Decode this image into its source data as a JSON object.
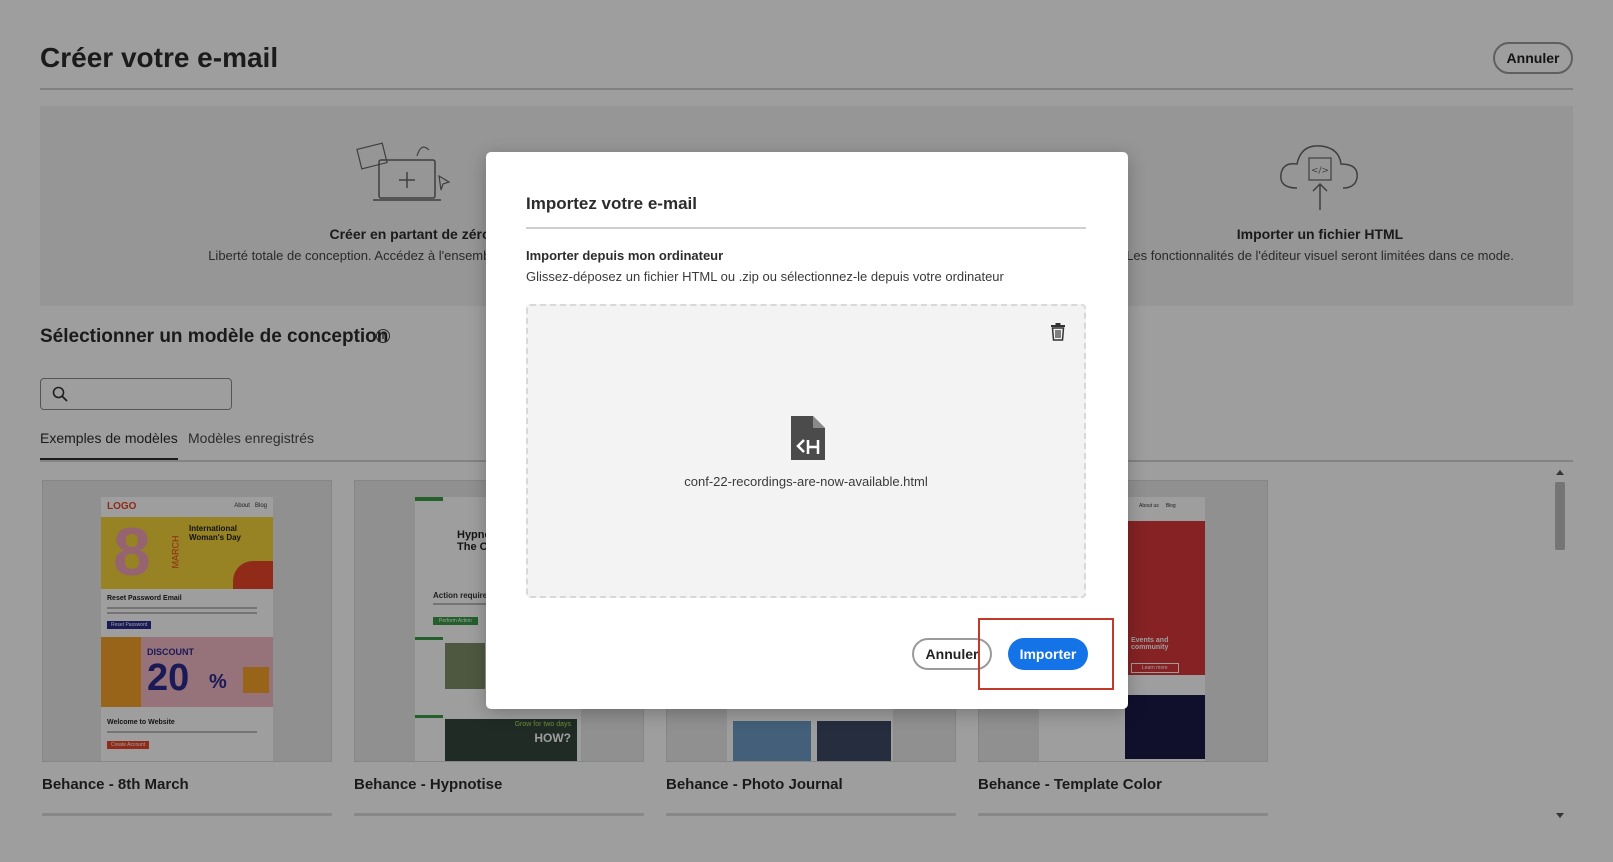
{
  "page": {
    "title": "Créer votre e-mail",
    "cancel_label": "Annuler"
  },
  "options": {
    "scratch": {
      "title": "Créer en partant de zéro",
      "description": "Liberté totale de conception. Accédez à l'ensemble des fonctionnalités"
    },
    "html": {
      "title": "Importer un fichier HTML",
      "description": "Les fonctionnalités de l'éditeur visuel seront limitées dans ce mode."
    }
  },
  "templates_section": {
    "title": "Sélectionner un modèle de conception",
    "search_placeholder": "",
    "tabs": [
      {
        "label": "Exemples de modèles",
        "active": true
      },
      {
        "label": "Modèles enregistrés",
        "active": false
      }
    ],
    "cards": [
      {
        "name": "Behance - 8th March"
      },
      {
        "name": "Behance - Hypnotise"
      },
      {
        "name": "Behance - Photo Journal"
      },
      {
        "name": "Behance - Template Color"
      }
    ],
    "card1_thumb": {
      "logo": "LOGO",
      "nav": [
        "About",
        "Blog"
      ],
      "big_number": "8",
      "vertical_text": "MARCH",
      "headline": "International Woman's Day",
      "section1": "Reset Password Email",
      "button1": "Reset Password",
      "discount_label": "DISCOUNT",
      "discount_value": "20",
      "discount_unit": "%",
      "section2": "Welcome to Website",
      "button2": "Create Account"
    },
    "card2_thumb": {
      "headline": "Hypnotise Into The Christmas",
      "section": "Action required",
      "button": "Perform Action",
      "grow_text": "Grow for two days",
      "how_text": "HOW?"
    },
    "card4_thumb": {
      "nav": [
        "About us",
        "Blog"
      ],
      "events_text": "Events and community",
      "button": "Learn more"
    }
  },
  "dialog": {
    "title": "Importez votre e-mail",
    "subtitle": "Importer depuis mon ordinateur",
    "description": "Glissez-déposez un fichier HTML ou .zip ou sélectionnez-le depuis votre ordinateur",
    "file_name": "conf-22-recordings-are-now-available.html",
    "cancel_label": "Annuler",
    "import_label": "Importer"
  },
  "colors": {
    "primary_button": "#1473e6",
    "highlight_border": "#c0392b",
    "overlay": "rgba(0,0,0,0.38)"
  },
  "icons": {
    "trash": "trash-icon",
    "file": "html-file-icon",
    "search": "search-icon",
    "info": "info-icon",
    "create": "create-from-scratch-icon",
    "cloud": "cloud-upload-icon"
  }
}
